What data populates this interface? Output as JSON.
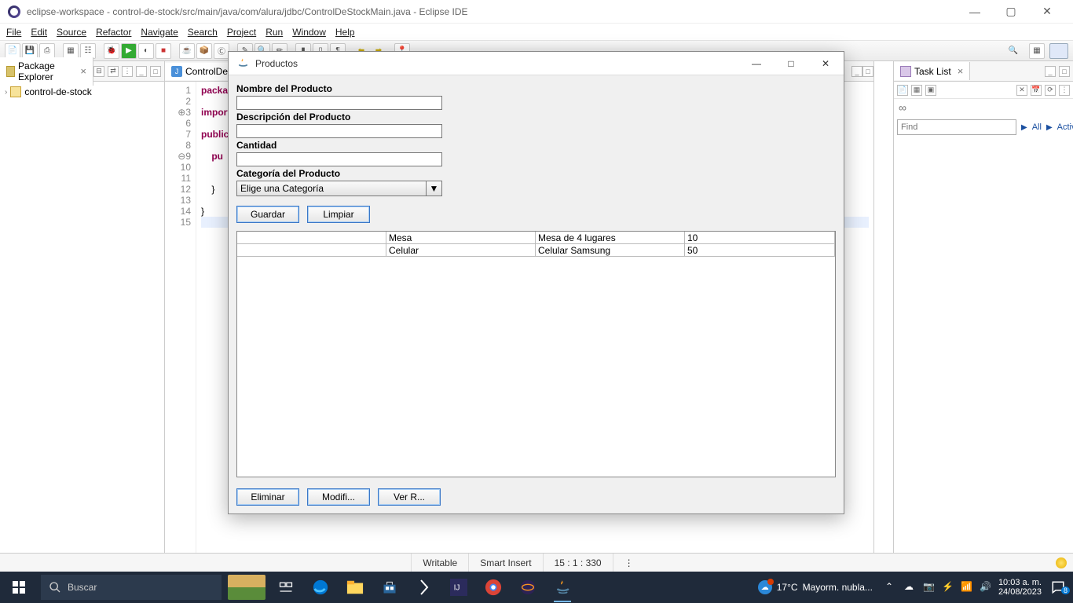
{
  "window": {
    "title": "eclipse-workspace - control-de-stock/src/main/java/com/alura/jdbc/ControlDeStockMain.java - Eclipse IDE"
  },
  "menu": {
    "file": "File",
    "edit": "Edit",
    "source": "Source",
    "refactor": "Refactor",
    "navigate": "Navigate",
    "search": "Search",
    "project": "Project",
    "run": "Run",
    "window": "Window",
    "help": "Help"
  },
  "pkgExplorer": {
    "title": "Package Explorer",
    "project": "control-de-stock"
  },
  "editor": {
    "tab": "ControlDe",
    "lines": {
      "l1": "1",
      "l2": "2",
      "l3": "3",
      "l6": "6",
      "l7": "7",
      "l8": "8",
      "l9": "9",
      "l10": "10",
      "l11": "11",
      "l12": "12",
      "l13": "13",
      "l14": "14",
      "l15": "15"
    },
    "code": {
      "l1": "packag",
      "l3": "import",
      "l7": "public",
      "l9": "pu",
      "l12": "}",
      "l14": "}"
    }
  },
  "taskList": {
    "title": "Task List",
    "findPlaceholder": "Find",
    "all": "All",
    "activate": "Activate..."
  },
  "dialog": {
    "title": "Productos",
    "labels": {
      "nombre": "Nombre del Producto",
      "descripcion": "Descripción del Producto",
      "cantidad": "Cantidad",
      "categoria": "Categoría del Producto"
    },
    "comboValue": "Elige una Categoría",
    "buttons": {
      "guardar": "Guardar",
      "limpiar": "Limpiar",
      "eliminar": "Eliminar",
      "modificar": "Modifi...",
      "ver": "Ver R..."
    },
    "rows": [
      {
        "c1": "",
        "c2": "Mesa",
        "c3": "Mesa de 4 lugares",
        "c4": "10"
      },
      {
        "c1": "",
        "c2": "Celular",
        "c3": "Celular Samsung",
        "c4": "50"
      }
    ]
  },
  "status": {
    "writable": "Writable",
    "smartInsert": "Smart Insert",
    "caret": "15 : 1 : 330"
  },
  "taskbar": {
    "searchPlaceholder": "Buscar",
    "weatherTemp": "17°C",
    "weatherDesc": "Mayorm. nubla...",
    "time": "10:03 a. m.",
    "date": "24/08/2023",
    "notifCount": "8"
  }
}
